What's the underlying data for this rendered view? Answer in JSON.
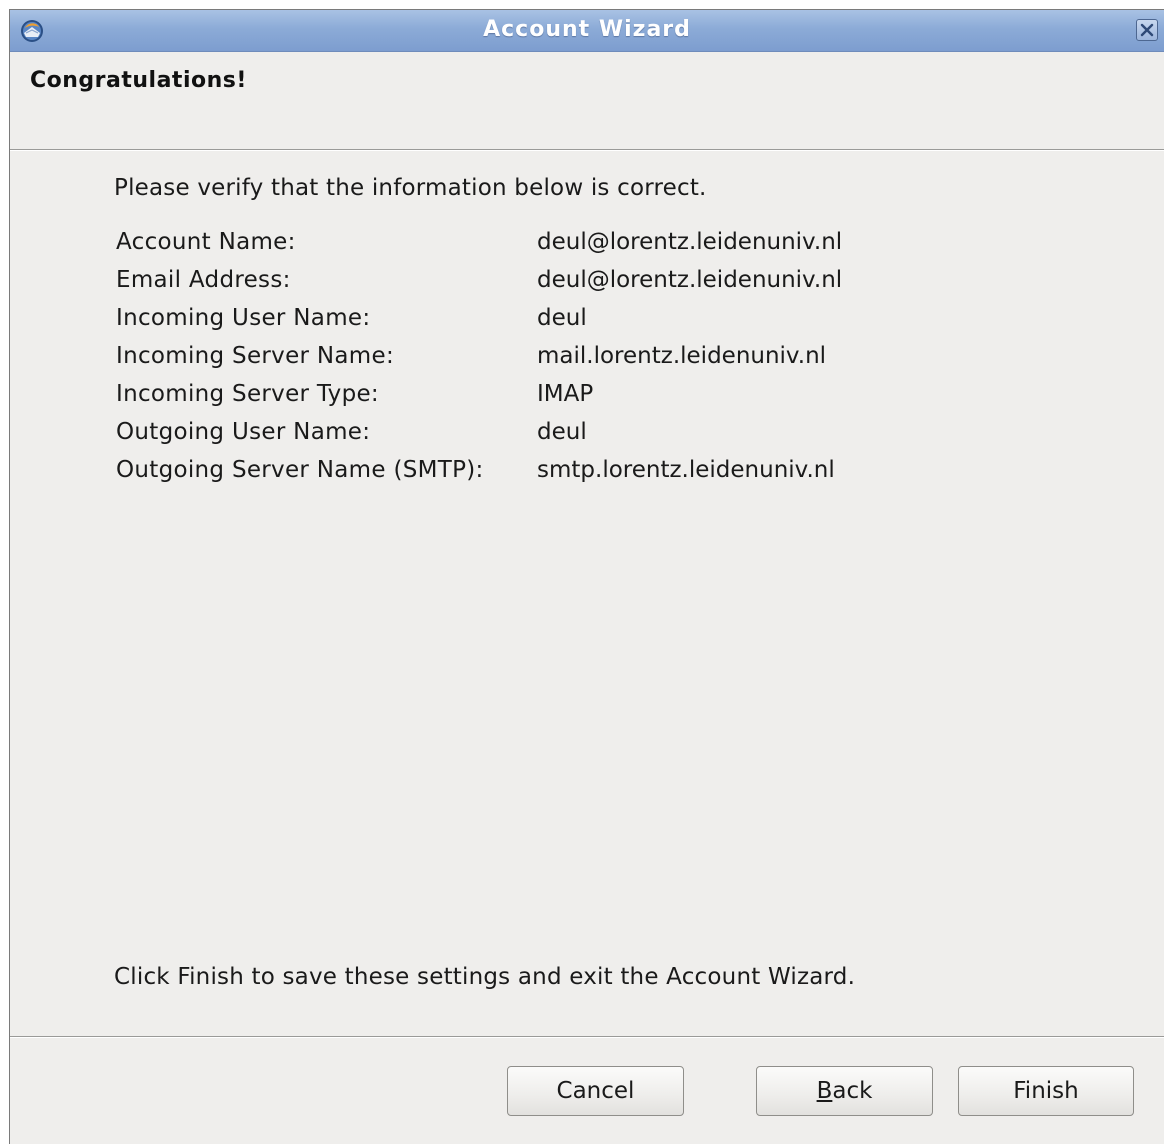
{
  "window": {
    "title": "Account Wizard",
    "app_icon": "thunderbird-icon",
    "close_icon": "close-icon"
  },
  "page": {
    "title": "Congratulations!",
    "intro": "Please verify that the information below is correct.",
    "footer_note": "Click Finish to save these settings and exit the Account Wizard."
  },
  "details": [
    {
      "label": "Account Name:",
      "value": "deul@lorentz.leidenuniv.nl"
    },
    {
      "label": "Email Address:",
      "value": "deul@lorentz.leidenuniv.nl"
    },
    {
      "label": "Incoming User Name:",
      "value": "deul"
    },
    {
      "label": "Incoming Server Name:",
      "value": "mail.lorentz.leidenuniv.nl"
    },
    {
      "label": "Incoming Server Type:",
      "value": "IMAP"
    },
    {
      "label": "Outgoing User Name:",
      "value": "deul"
    },
    {
      "label": "Outgoing Server Name (SMTP):",
      "value": "smtp.lorentz.leidenuniv.nl"
    }
  ],
  "buttons": {
    "cancel": "Cancel",
    "back_mnemonic": "B",
    "back_rest": "ack",
    "finish": "Finish"
  },
  "colors": {
    "titlebar": "#8cabd7",
    "window_bg": "#efeeec"
  }
}
